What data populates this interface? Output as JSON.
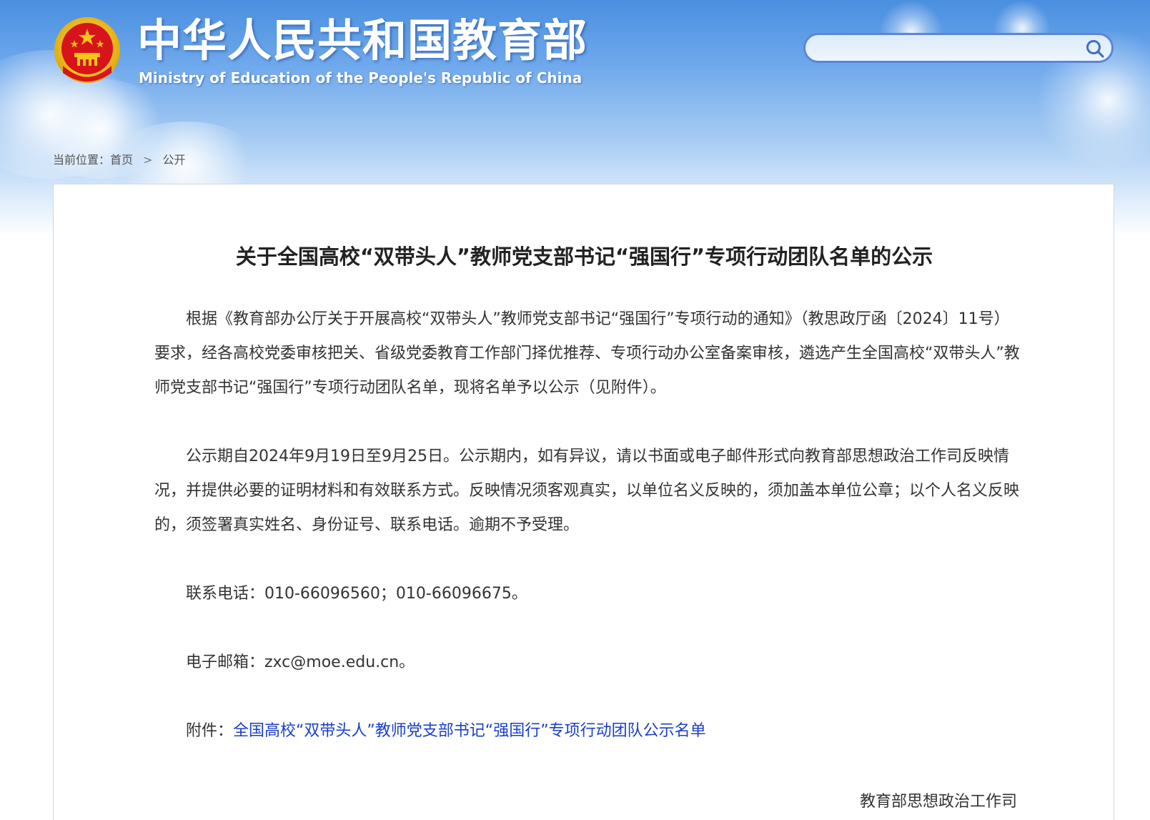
{
  "header": {
    "site_title": "中华人民共和国教育部",
    "site_subtitle": "Ministry of Education of the People's Republic of China",
    "search": {
      "placeholder": "",
      "icon": "search-icon"
    }
  },
  "breadcrumb": {
    "prefix": "当前位置：",
    "items": [
      "首页",
      "公开"
    ],
    "separator": ">"
  },
  "article": {
    "title": "关于全国高校“双带头人”教师党支部书记“强国行”专项行动团队名单的公示",
    "paragraphs": [
      "根据《教育部办公厅关于开展高校“双带头人”教师党支部书记“强国行”专项行动的通知》（教思政厅函〔2024〕11号）要求，经各高校党委审核把关、省级党委教育工作部门择优推荐、专项行动办公室备案审核，遴选产生全国高校“双带头人”教师党支部书记“强国行”专项行动团队名单，现将名单予以公示（见附件）。",
      "公示期自2024年9月19日至9月25日。公示期内，如有异议，请以书面或电子邮件形式向教育部思想政治工作司反映情况，并提供必要的证明材料和有效联系方式。反映情况须客观真实，以单位名义反映的，须加盖本单位公章；以个人名义反映的，须签署真实姓名、身份证号、联系电话。逾期不予受理。",
      "联系电话：010-66096560；010-66096675。",
      "电子邮箱：zxc@moe.edu.cn。"
    ],
    "attachment_label": "附件：",
    "attachment_link": "全国高校“双带头人”教师党支部书记“强国行”专项行动团队公示名单",
    "signature": "教育部思想政治工作司"
  },
  "colors": {
    "header_blue": "#4a8fe0",
    "link_blue": "#1a3fc9",
    "emblem_red": "#d7141a",
    "emblem_gold": "#f5c518"
  }
}
